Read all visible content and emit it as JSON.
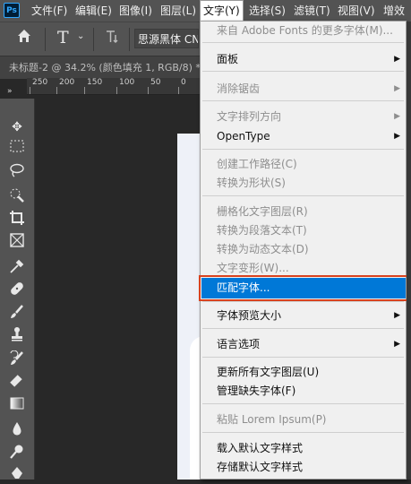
{
  "menubar": {
    "logo": "Ps",
    "items": [
      "文件(F)",
      "编辑(E)",
      "图像(I)",
      "图层(L)",
      "文字(Y)",
      "选择(S)",
      "滤镜(T)",
      "视图(V)",
      "增效"
    ]
  },
  "options": {
    "home_icon": "home-icon",
    "text_tool_glyph": "T",
    "font_family": "思源黑体 CN"
  },
  "tab": {
    "title": "未标题-2 @ 34.2% (颜色填充 1, RGB/8) *"
  },
  "ruler": {
    "ticks": [
      "250",
      "200",
      "150",
      "100",
      "50",
      "0"
    ]
  },
  "tools": [
    "move-tool",
    "marquee-tool",
    "lasso-tool",
    "quick-select-tool",
    "crop-tool",
    "frame-tool",
    "eyedropper-tool",
    "healing-brush-tool",
    "brush-tool",
    "stamp-tool",
    "history-brush-tool",
    "eraser-tool",
    "gradient-tool",
    "blur-tool",
    "dodge-tool",
    "pen-tool"
  ],
  "menu": {
    "items": [
      {
        "label": "来自 Adobe Fonts 的更多字体(M)...",
        "disabled": true,
        "submenu": false
      },
      {
        "label": "面板",
        "disabled": false,
        "submenu": true
      },
      {
        "label": "消除锯齿",
        "disabled": true,
        "submenu": true
      },
      {
        "label": "文字排列方向",
        "disabled": true,
        "submenu": true
      },
      {
        "label": "OpenType",
        "disabled": false,
        "submenu": true
      },
      {
        "label": "创建工作路径(C)",
        "disabled": true,
        "submenu": false
      },
      {
        "label": "转换为形状(S)",
        "disabled": true,
        "submenu": false
      },
      {
        "label": "栅格化文字图层(R)",
        "disabled": true,
        "submenu": false
      },
      {
        "label": "转换为段落文本(T)",
        "disabled": true,
        "submenu": false
      },
      {
        "label": "转换为动态文本(D)",
        "disabled": true,
        "submenu": false
      },
      {
        "label": "文字变形(W)...",
        "disabled": true,
        "submenu": false
      },
      {
        "label": "匹配字体...",
        "disabled": false,
        "submenu": false,
        "highlighted": true
      },
      {
        "label": "字体预览大小",
        "disabled": false,
        "submenu": true
      },
      {
        "label": "语言选项",
        "disabled": false,
        "submenu": true
      },
      {
        "label": "更新所有文字图层(U)",
        "disabled": false,
        "submenu": false
      },
      {
        "label": "管理缺失字体(F)",
        "disabled": false,
        "submenu": false
      },
      {
        "label": "粘贴 Lorem Ipsum(P)",
        "disabled": true,
        "submenu": false
      },
      {
        "label": "载入默认文字样式",
        "disabled": false,
        "submenu": false
      },
      {
        "label": "存储默认文字样式",
        "disabled": false,
        "submenu": false
      }
    ]
  },
  "colors": {
    "highlight": "#0078d7",
    "highlight_outline": "#d9421e",
    "menu_bg": "#f0f0f0",
    "ui_bg": "#535353"
  }
}
